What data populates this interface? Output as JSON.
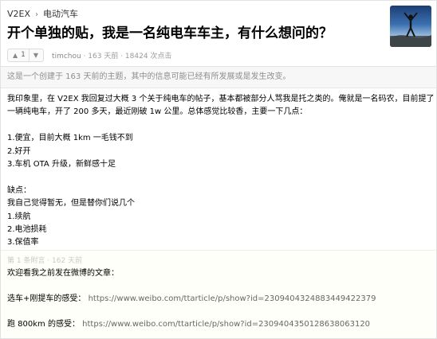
{
  "breadcrumb": {
    "site": "V2EX",
    "separator": "›",
    "node": "电动汽车"
  },
  "topic": {
    "title": "开个单独的贴，我是一名纯电车车主，有什么想问的？",
    "vote_count": "1",
    "vote_up_icon": "▲",
    "vote_down_icon": "▼",
    "author": "timchou",
    "meta": " · 163 天前 · 18424 次点击"
  },
  "notice": "这是一个创建于 163 天前的主题，其中的信息可能已经有所发展或是发生改变。",
  "content": {
    "lines": [
      "我印象里，在 V2EX 我回复过大概 3 个关于纯电车的帖子，基本都被部分人骂我是托之类的。俺就是一名码农，目前提了",
      "一辆纯电车，开了 200 多天，最近刚破 1w 公里。总体感觉比较香，主要一下几点：",
      "",
      "1.便宜，目前大概 1km 一毛钱不到",
      "2.好开",
      "3.车机 OTA 升级，新鲜感十足",
      "",
      "缺点：",
      "我自己觉得暂无，但是替你们说几个",
      "1.续航",
      "2.电池损耗",
      "3.保值率"
    ]
  },
  "append": {
    "header": "第 1 条附言  ·  162 天前",
    "intro": "欢迎看我之前发在微博的文章：",
    "link1_label": "选车+刚提车的感受：",
    "link1_url": "https://www.weibo.com/ttarticle/p/show?id=2309404324883449422379",
    "link2_label": "跑 800km 的感受：",
    "link2_url": "https://www.weibo.com/ttarticle/p/show?id=2309404350128638063120"
  }
}
